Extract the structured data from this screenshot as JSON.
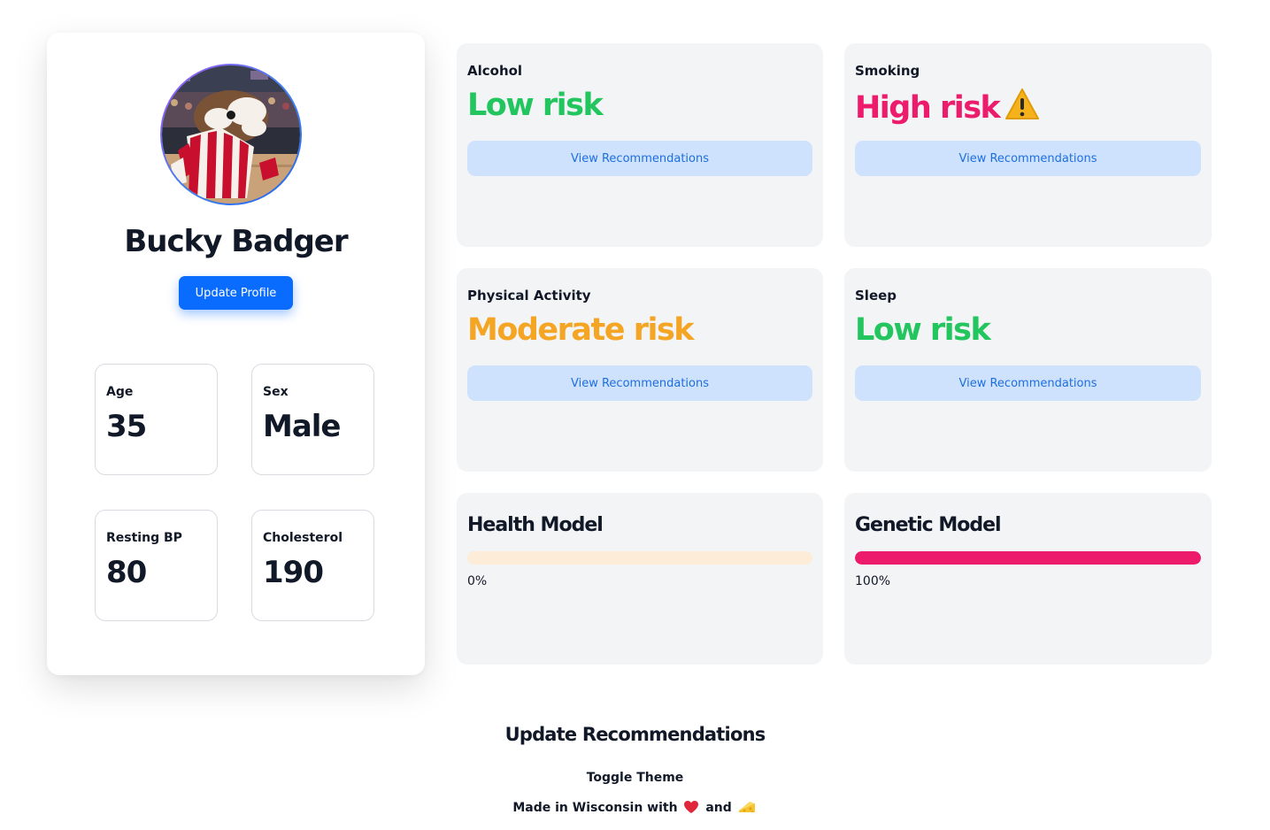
{
  "profile": {
    "name": "Bucky Badger",
    "avatar_icon": "bucky-badger-mascot",
    "update_button_label": "Update Profile",
    "stats": [
      {
        "label": "Age",
        "value": "35"
      },
      {
        "label": "Sex",
        "value": "Male"
      },
      {
        "label": "Resting BP",
        "value": "80"
      },
      {
        "label": "Cholesterol",
        "value": "190"
      }
    ]
  },
  "risks": [
    {
      "label": "Alcohol",
      "value": "Low risk",
      "color": "#22c55e",
      "button": "View Recommendations"
    },
    {
      "label": "Smoking",
      "value": "High risk",
      "color": "#ec1b6b",
      "icon": "warning-icon",
      "button": "View Recommendations"
    },
    {
      "label": "Physical Activity",
      "value": "Moderate risk",
      "color": "#f5a524",
      "button": "View Recommendations"
    },
    {
      "label": "Sleep",
      "value": "Low risk",
      "color": "#22c55e",
      "button": "View Recommendations"
    }
  ],
  "models": [
    {
      "title": "Health Model",
      "percent": 0,
      "percent_text": "0%",
      "track_color": "#fdecd8",
      "fill_color": "#f5a524"
    },
    {
      "title": "Genetic Model",
      "percent": 100,
      "percent_text": "100%",
      "track_color": "#fde2ea",
      "fill_color": "#ec1b6b"
    }
  ],
  "footer": {
    "title": "Update Recommendations",
    "toggle_theme": "Toggle Theme",
    "made_in_prefix": "Made in Wisconsin with",
    "made_in_and": "and",
    "heart_icon": "heart-icon",
    "cheese_icon": "cheese-icon"
  },
  "colors": {
    "primary_button": "#0a6cff",
    "secondary_button_bg": "#cfe2fd",
    "secondary_button_text": "#1d6fe0",
    "card_bg": "#f3f4f6"
  }
}
